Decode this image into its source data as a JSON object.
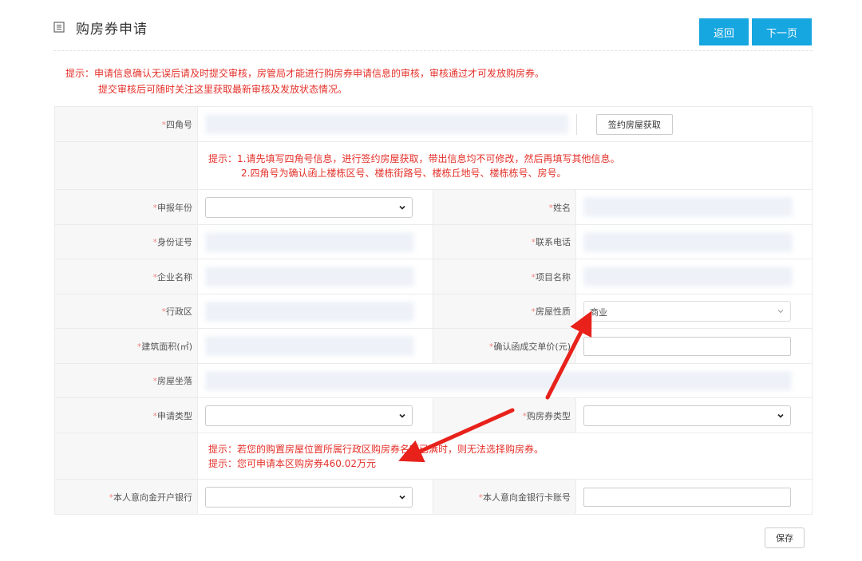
{
  "header": {
    "title": "购房券申请",
    "back_label": "返回",
    "next_label": "下一页"
  },
  "notice": {
    "line1": "提示：申请信息确认无误后请及时提交审核，房管局才能进行购房券申请信息的审核，审核通过才可发放购房券。",
    "line2": "提交审核后可随时关注这里获取最新审核及发放状态情况。"
  },
  "form": {
    "required_mark": "*",
    "sijiao_label": "四角号",
    "fetch_button": "签约房屋获取",
    "tip1_line1": "提示：1.请先填写四角号信息，进行签约房屋获取，带出信息均不可修改，然后再填写其他信息。",
    "tip1_line2": "2.四角号为确认函上楼栋区号、楼栋街路号、楼栋丘地号、楼栋栋号、房号。",
    "year_label": "申报年份",
    "name_label": "姓名",
    "id_label": "身份证号",
    "phone_label": "联系电话",
    "company_label": "企业名称",
    "project_label": "项目名称",
    "district_label": "行政区",
    "nature_label": "房屋性质",
    "nature_value": "商业",
    "area_label": "建筑面积(㎡)",
    "price_label": "确认函成交单价(元)",
    "location_label": "房屋坐落",
    "apply_type_label": "申请类型",
    "coupon_type_label": "购房券类型",
    "tip2_line1": "提示：若您的购置房屋位置所属行政区购房券名额已满时，则无法选择购房券。",
    "tip2_line2": "提示：您可申请本区购房券460.02万元",
    "bank_label": "本人意向金开户银行",
    "card_label": "本人意向金银行卡账号"
  },
  "footer": {
    "save_label": "保存"
  },
  "colors": {
    "accent": "#16a6e0",
    "warning_text": "#e4312a",
    "annotation_arrow": "#e8211b"
  }
}
